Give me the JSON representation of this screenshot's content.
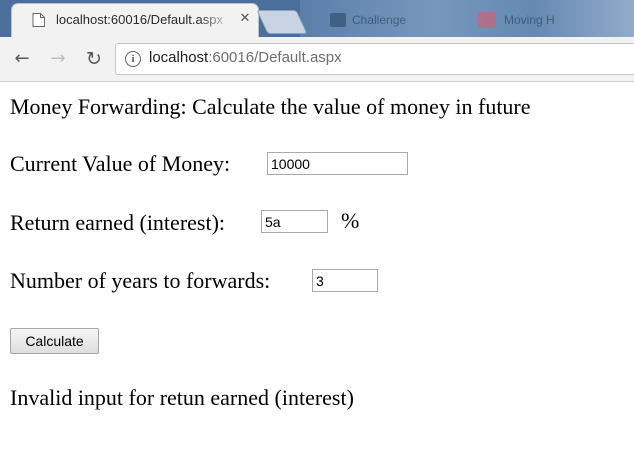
{
  "browser": {
    "active_tab": {
      "title": "localhost:60016/Default.aspx",
      "close_glyph": "✕",
      "favicon": "page-icon"
    },
    "background_tabs": [
      {
        "title": "Challenge",
        "favicon": "app-icon"
      },
      {
        "title": "Moving H",
        "favicon": "app-icon"
      }
    ],
    "toolbar": {
      "back_glyph": "←",
      "forward_glyph": "→",
      "reload_glyph": "↻",
      "info_glyph": "i",
      "url_host": "localhost",
      "url_rest": ":60016/Default.aspx"
    }
  },
  "page": {
    "heading": "Money Forwarding: Calculate the value of money in future",
    "current_value": {
      "label": "Current Value of Money:",
      "value": "10000"
    },
    "return_earned": {
      "label": "Return earned (interest):",
      "value": "5a",
      "suffix": "%"
    },
    "years": {
      "label": "Number of years to forwards:",
      "value": "3"
    },
    "calculate_label": "Calculate",
    "message": "Invalid input for retun earned (interest)"
  },
  "colors": {
    "tabstrip": "#4a6f9a",
    "toolbar": "#f2f2f2",
    "input_border": "#a9a9a9"
  }
}
